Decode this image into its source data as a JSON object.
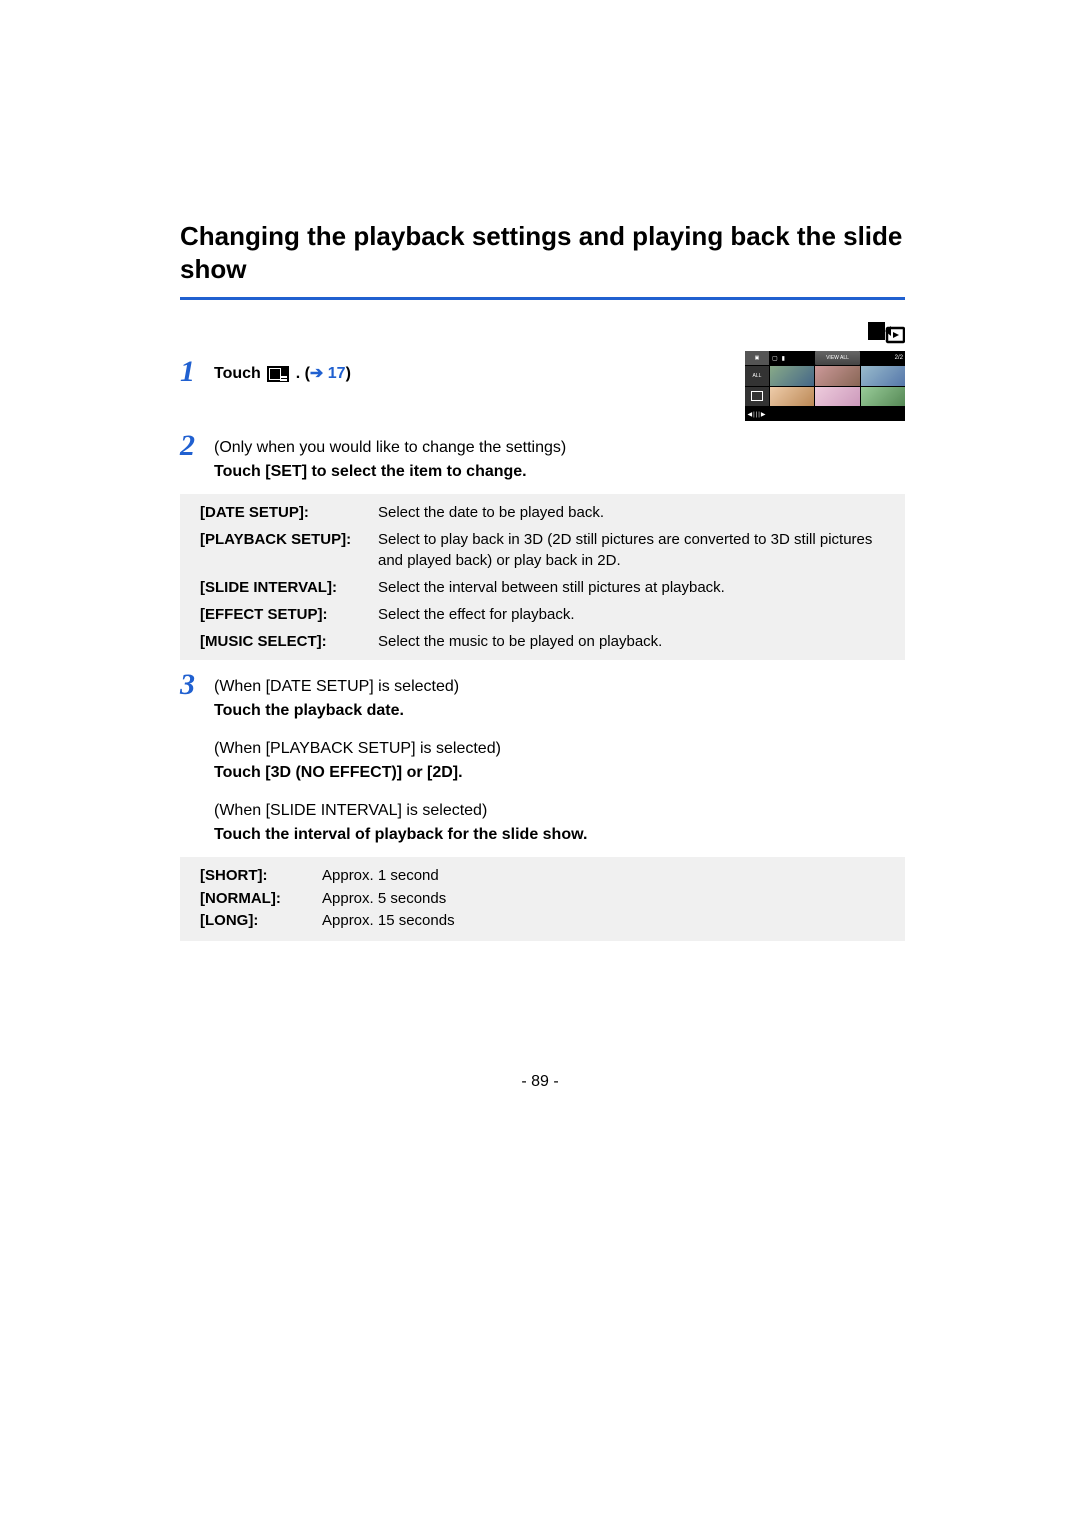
{
  "heading": "Changing the playback settings and playing back the slide show",
  "screenshot": {
    "viewall": "VIEW ALL",
    "page": "2/2",
    "all": "ALL",
    "nav": "◀|||▶"
  },
  "step1": {
    "num": "1",
    "touch": "Touch ",
    "period": " . (",
    "arrow": "➔",
    "linkref": " 17",
    "close": ")"
  },
  "step2": {
    "num": "2",
    "intro": "(Only when you would like to change the settings)",
    "bold": "Touch [SET] to select the item to change."
  },
  "options": [
    {
      "label": "[DATE SETUP]:",
      "desc": "Select the date to be played back."
    },
    {
      "label": "[PLAYBACK SETUP]:",
      "desc": "Select to play back in 3D (2D still pictures are converted to 3D still pictures and played back) or play back in 2D."
    },
    {
      "label": "[SLIDE INTERVAL]:",
      "desc": "Select the interval between still pictures at playback."
    },
    {
      "label": "[EFFECT SETUP]:",
      "desc": "Select the effect for playback."
    },
    {
      "label": "[MUSIC SELECT]:",
      "desc": "Select the music to be played on playback."
    }
  ],
  "step3": {
    "num": "3",
    "a_intro": "(When [DATE SETUP] is selected)",
    "a_bold": "Touch the playback date.",
    "b_intro": "(When [PLAYBACK SETUP] is selected)",
    "b_bold": "Touch [3D (NO EFFECT)] or [2D].",
    "c_intro": "(When [SLIDE INTERVAL] is selected)",
    "c_bold": "Touch the interval of playback for the slide show."
  },
  "intervals": [
    {
      "label": "[SHORT]:",
      "desc": "Approx. 1 second"
    },
    {
      "label": "[NORMAL]:",
      "desc": "Approx. 5 seconds"
    },
    {
      "label": "[LONG]:",
      "desc": "Approx. 15 seconds"
    }
  ],
  "pagenum": "- 89 -"
}
